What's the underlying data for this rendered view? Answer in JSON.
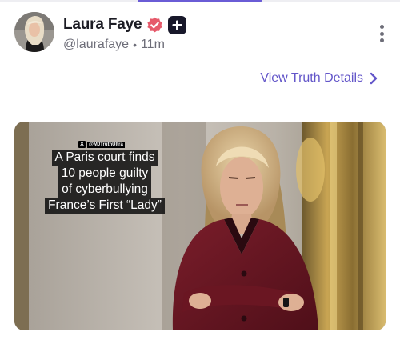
{
  "post": {
    "author": {
      "display_name": "Laura Faye",
      "handle": "@laurafaye",
      "separator": "•",
      "time_ago": "11m",
      "verified": true,
      "plus_badge": true
    },
    "actions": {
      "more_icon": "vertical-ellipsis-icon",
      "view_details_label": "View Truth Details",
      "view_details_icon": "chevron-right-icon"
    },
    "media": {
      "watermark": "@MJTruthUltra",
      "caption_lines": [
        "A Paris court finds",
        "10 people guilty",
        "of cyberbullying",
        "France’s First “Lady”"
      ]
    }
  },
  "colors": {
    "accent": "#6356c9",
    "tab_indicator": "#6a5cd6",
    "verified_badge": "#e65a6b",
    "plus_badge": "#18182a"
  }
}
